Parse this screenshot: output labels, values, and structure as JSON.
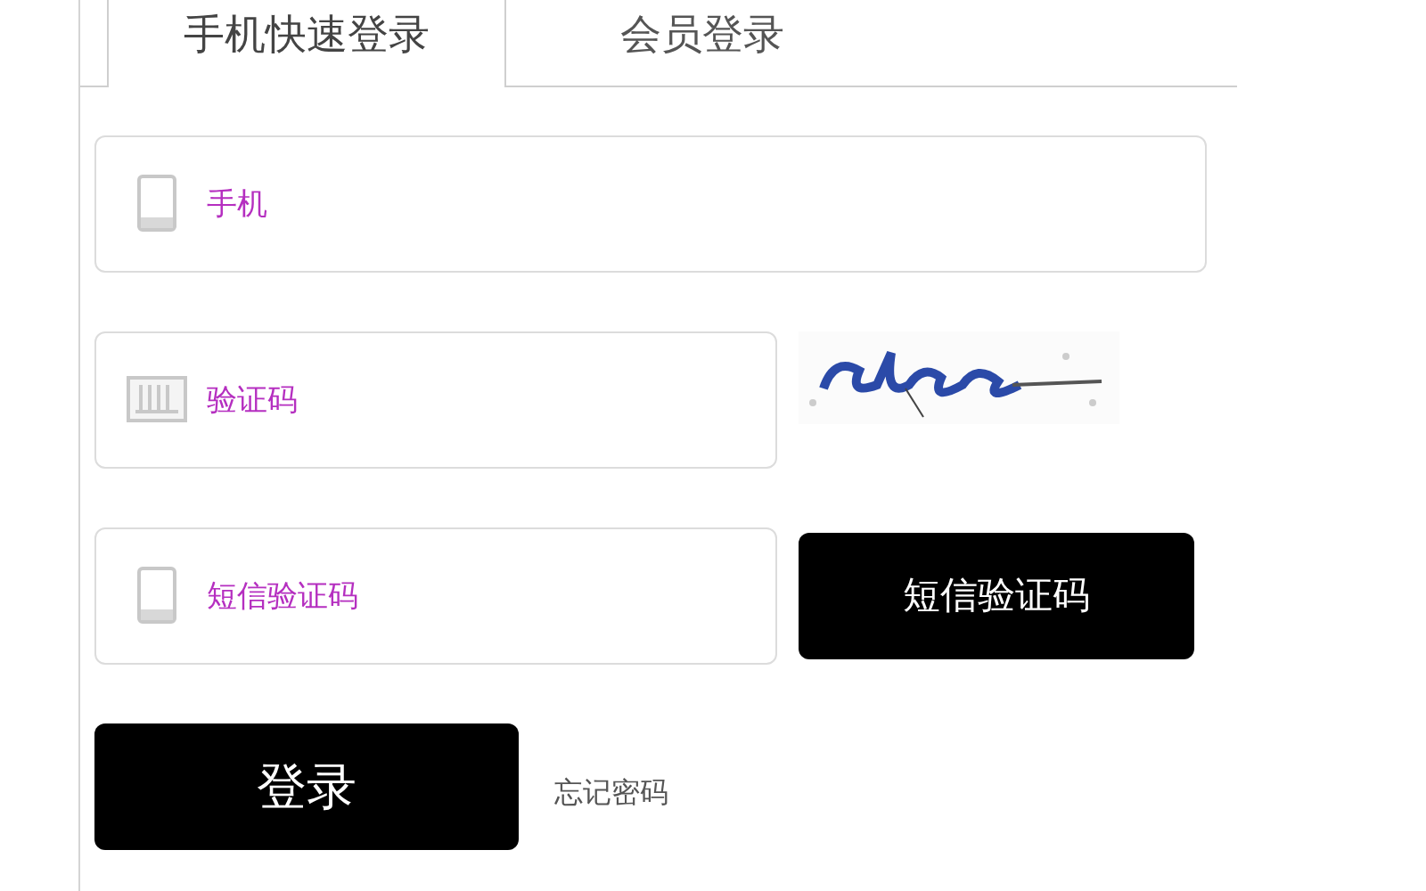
{
  "tabs": [
    {
      "label": "手机快速登录",
      "selected": true
    },
    {
      "label": "会员登录",
      "selected": false
    }
  ],
  "fields": [
    {
      "kind": "phone",
      "placeholder": "手机"
    },
    {
      "kind": "captcha",
      "placeholder": "验证码"
    },
    {
      "kind": "sms",
      "placeholder": "短信验证码",
      "button": "短信验证码"
    }
  ],
  "login_button": "登录",
  "forgot_link": "忘记密码"
}
